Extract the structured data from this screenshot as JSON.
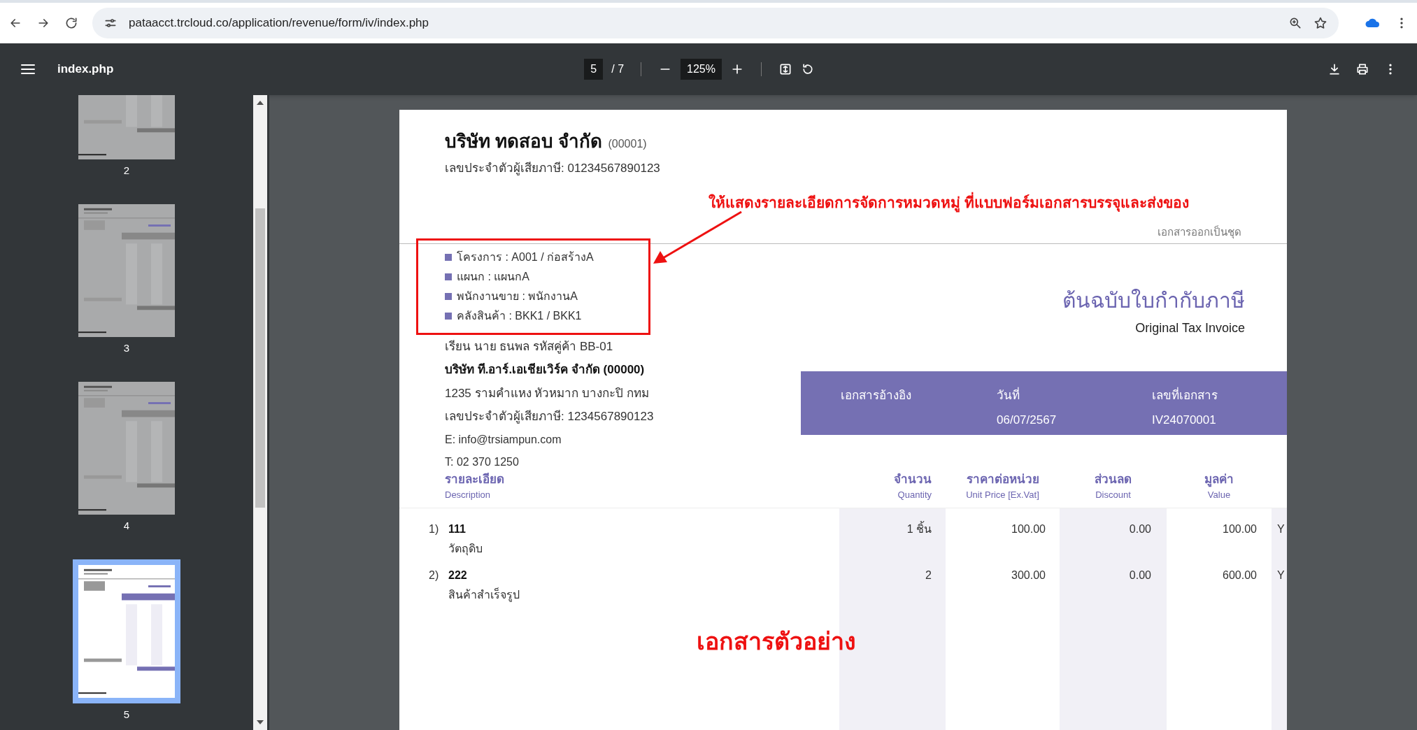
{
  "browser": {
    "url": "pataacct.trcloud.co/application/revenue/form/iv/index.php"
  },
  "pdf_toolbar": {
    "title": "index.php",
    "page": "5",
    "page_total": "/ 7",
    "zoom": "125%"
  },
  "thumbnails": [
    {
      "label": "2",
      "selected": false
    },
    {
      "label": "3",
      "selected": false
    },
    {
      "label": "4",
      "selected": false
    },
    {
      "label": "5",
      "selected": true
    }
  ],
  "document": {
    "company_name": "บริษัท ทดสอบ จำกัด",
    "company_code": "(00001)",
    "tax_id": "เลขประจำตัวผู้เสียภาษี: 01234567890123",
    "set_note": "เอกสารออกเป็นชุด",
    "categories": [
      "โครงการ : A001 / ก่อสร้างA",
      "แผนก : แผนกA",
      "พนักงานขาย : พนักงานA",
      "คลังสินค้า : BKK1 / BKK1"
    ],
    "customer": {
      "greeting": "เรียน นาย ธนพล รหัสคู่ค้า BB-01",
      "name": "บริษัท ที.อาร์.เอเชียเวิร์ค จำกัด (00000)",
      "address": "1235 รามคำแหง หัวหมาก บางกะปิ กทม",
      "tax_id": "เลขประจำตัวผู้เสียภาษี: 1234567890123",
      "email": "E: info@trsiampun.com",
      "phone": "T: 02 370 1250"
    },
    "title": "ต้นฉบับใบกำกับภาษี",
    "subtitle": "Original Tax Invoice",
    "info_band": [
      {
        "label": "เอกสารอ้างอิง"
      },
      {
        "label": "วันที่",
        "value": "06/07/2567"
      },
      {
        "label": "เลขที่เอกสาร",
        "value": "IV24070001"
      }
    ],
    "columns": [
      {
        "th": "รายละเอียด",
        "en": "Description"
      },
      {
        "th": "จำนวน",
        "en": "Quantity"
      },
      {
        "th": "ราคาต่อหน่วย",
        "en": "Unit Price [Ex.Vat]"
      },
      {
        "th": "ส่วนลด",
        "en": "Discount"
      },
      {
        "th": "มูลค่า",
        "en": "Value"
      }
    ],
    "rows": [
      {
        "index": "1)",
        "code": "111",
        "name": "วัตถุดิบ",
        "qty": "1 ชิ้น",
        "price": "100.00",
        "discount": "0.00",
        "value": "100.00",
        "flag": "Y"
      },
      {
        "index": "2)",
        "code": "222",
        "name": "สินค้าสำเร็จรูป",
        "qty": "2",
        "price": "300.00",
        "discount": "0.00",
        "value": "600.00",
        "flag": "Y"
      }
    ]
  },
  "annotation": {
    "note": "ให้แสดงรายละเอียดการจัดการหมวดหมู่ ที่แบบฟอร์มเอกสารบรรจุและส่งของ",
    "sample_mark": "เอกสารตัวอย่าง"
  }
}
